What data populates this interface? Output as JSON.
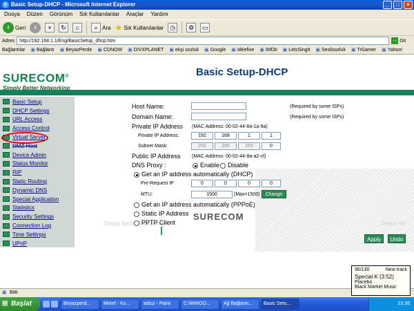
{
  "window": {
    "title": "Basic Setup-DHCP - Microsoft Internet Explorer"
  },
  "menu": [
    "Dosya",
    "Düzen",
    "Görünüm",
    "Sık Kullanılanlar",
    "Araçlar",
    "Yardım"
  ],
  "toolbar": {
    "back": "Geri",
    "search": "Ara",
    "favorites": "Sık Kullanılanlar"
  },
  "address": {
    "label": "Adres",
    "url": "http://192.168.1.1/Eng/BasicSetup_dhcp.htm",
    "go": "Git"
  },
  "links": {
    "label": "Bağlantılar",
    "items": [
      "Bağlantı",
      "BeyazPerde",
      "CDNOW",
      "DIVXPLANET",
      "ekşi sozluk",
      "Google",
      "Idéefixe",
      "IMDb",
      "LetsSingIt",
      "Seslisozluk",
      "TrGamer",
      "Yahoo!"
    ]
  },
  "page": {
    "logo": "SURECOM",
    "logo_mark": "®",
    "tagline": "Simply Better Networking",
    "title": "Basic Setup-DHCP",
    "sidebar": [
      "Basic Setup",
      "DHCP Settings",
      "URL Access",
      "Access Control",
      "Virtual Server",
      "DMZ Host",
      "Device Admin",
      "Status Monitor",
      "RIP",
      "Static Routing",
      "Dynamic DNS",
      "Special Application",
      "Statistics",
      "Security Settings",
      "Connection Log",
      "Time Settings",
      "UPnP"
    ],
    "form": {
      "host_name_label": "Host Name:",
      "domain_name_label": "Domain Name:",
      "required_note": "(Required by some ISPs)",
      "host_name_value": "",
      "domain_name_value": "",
      "private_ip_label": "Private IP Address",
      "private_mac": "(MAC Address: 00-02-44-8a-1a-9a)",
      "private_ip_field_label": "Private IP Address:",
      "private_ip": [
        "192",
        "168",
        "1",
        "1"
      ],
      "subnet_label": "Subnet Mask:",
      "subnet": [
        "255",
        "255",
        "255",
        "0"
      ],
      "public_ip_label": "Public IP Address",
      "public_mac": "(MAC Address: 00-02-44-8a-a2-cf)",
      "dns_proxy_label": "DNS Proxy :",
      "enable": "Enable",
      "disable": "Disable",
      "dhcp_option": "Get an IP address automatically (DHCP)",
      "prerequest_label": "Pre-Request IP",
      "prerequest": [
        "0",
        "0",
        "0",
        "0"
      ],
      "mtu_label": "MTU:",
      "mtu_value": "1500",
      "mtu_max": "(Max=1500)",
      "change_button": "Change",
      "pppoe_option": "Get an IP address automatically (PPPoE)",
      "static_option": "Static IP Address",
      "pptp_option": "PPTP Client"
    },
    "watermark": {
      "left_text": "Simply Better Networking",
      "right_text": "Simply Be",
      "logo": "SURECOM"
    },
    "apply_button": "Apply",
    "undo_button": "Undo"
  },
  "status": {
    "text": "Bitti"
  },
  "taskbar": {
    "start": "Başlat",
    "tasks": [
      "Beyazperd...",
      "Meret - Ko...",
      "adsız - Paint",
      "C:\\WINDO...",
      "Ağ Bağlantı...",
      "Basic Setu..."
    ],
    "clock": "23:39"
  },
  "notification": {
    "counter": "96/130",
    "new_track": "New track",
    "track": "Special K (3:52)",
    "artist": "Placebo",
    "album": "Black Market Music"
  }
}
